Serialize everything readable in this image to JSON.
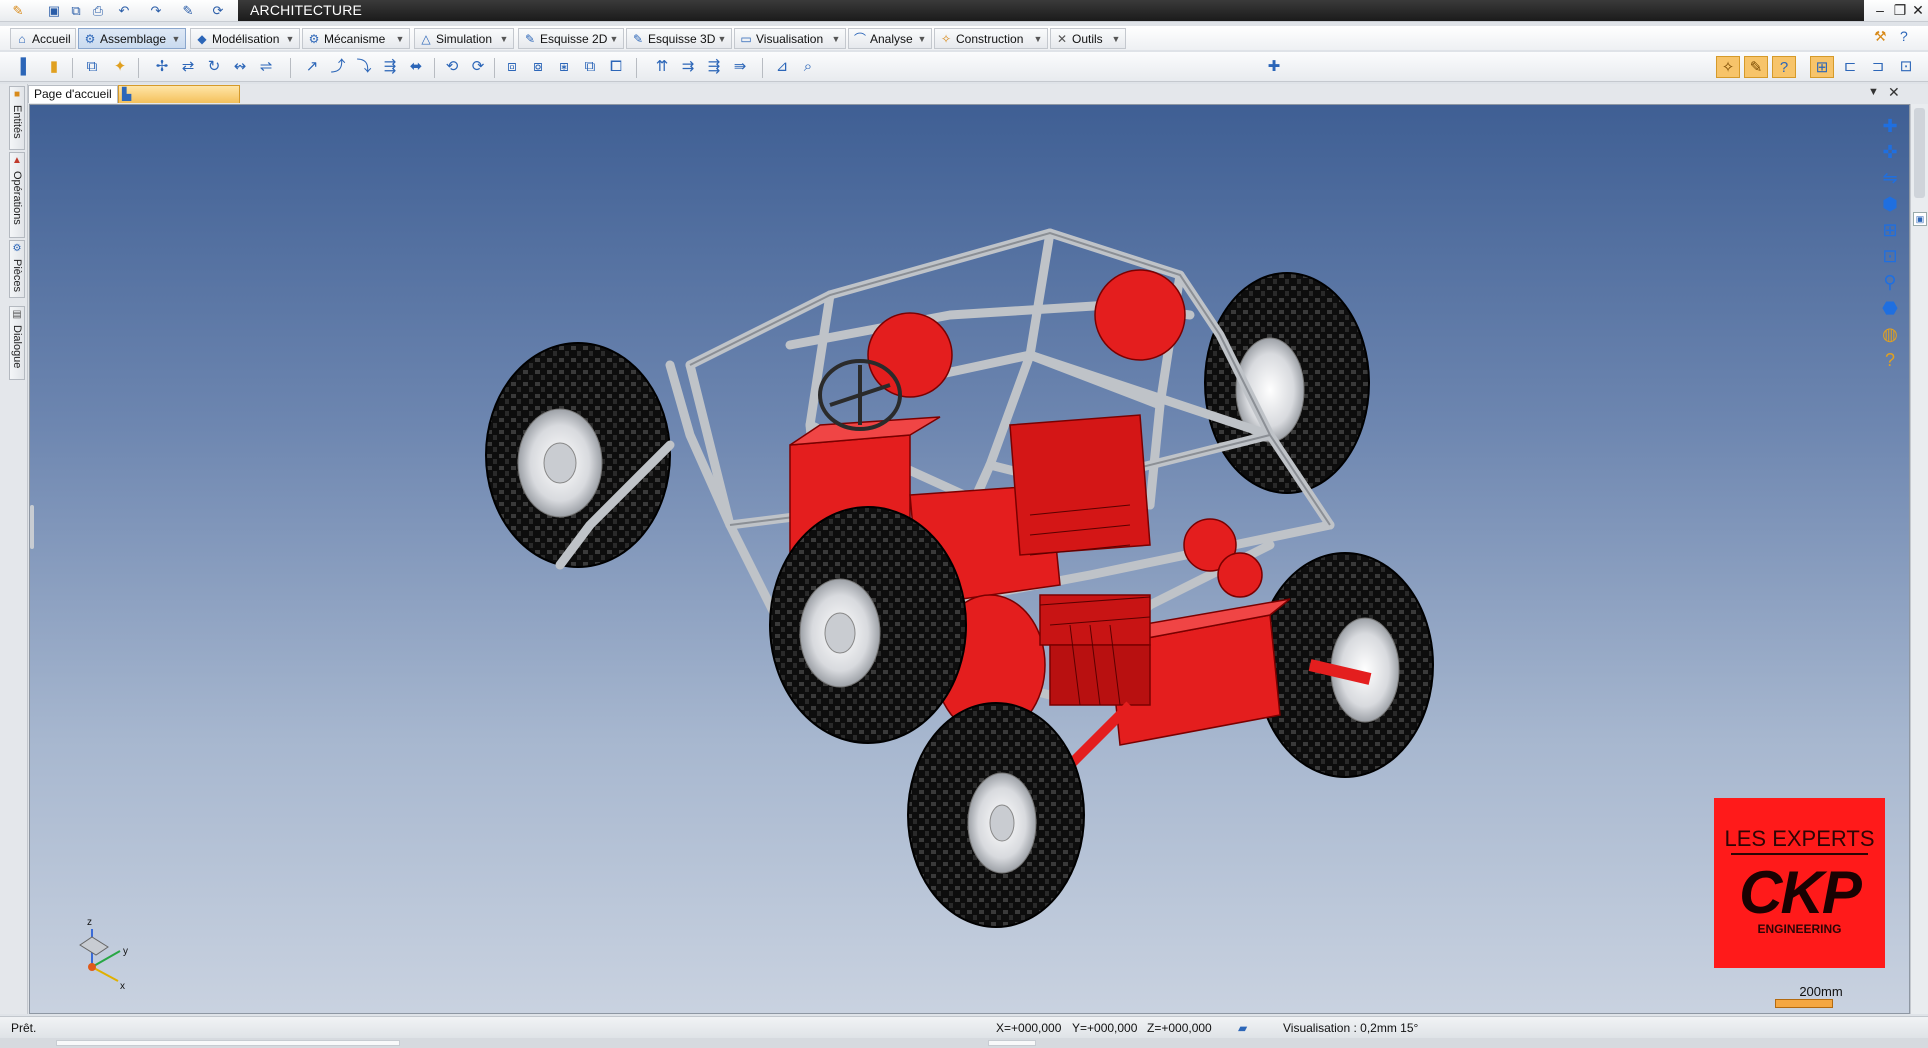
{
  "window": {
    "title": "ARCHITECTURE"
  },
  "tabs": [
    {
      "label": "Accueil",
      "icon": "home-icon"
    },
    {
      "label": "Assemblage",
      "icon": "assembly-icon"
    },
    {
      "label": "Modélisation",
      "icon": "modeling-icon"
    },
    {
      "label": "Mécanisme",
      "icon": "mechanism-icon"
    },
    {
      "label": "Simulation",
      "icon": "simulation-icon"
    },
    {
      "label": "Esquisse 2D",
      "icon": "sketch-2d-icon"
    },
    {
      "label": "Esquisse 3D",
      "icon": "sketch-3d-icon"
    },
    {
      "label": "Visualisation",
      "icon": "visualisation-icon"
    },
    {
      "label": "Analyse",
      "icon": "analysis-icon"
    },
    {
      "label": "Construction",
      "icon": "construction-icon"
    },
    {
      "label": "Outils",
      "icon": "tools-icon"
    }
  ],
  "documents": {
    "home_tab": "Page d'accueil"
  },
  "side_panel": {
    "tabs": [
      {
        "label": "Entités",
        "icon": "entities-icon"
      },
      {
        "label": "Opérations",
        "icon": "operations-icon"
      },
      {
        "label": "Pièces",
        "icon": "parts-icon"
      },
      {
        "label": "Dialogue",
        "icon": "dialog-icon"
      }
    ]
  },
  "viewport": {
    "model": "buggy-assembly",
    "triad": {
      "x": "x",
      "y": "y",
      "z": "z"
    },
    "logo": {
      "line1": "LES EXPERTS",
      "line2": "CKP",
      "line3": "ENGINEERING"
    },
    "scale_label": "200mm"
  },
  "status": {
    "text": "Prêt.",
    "x": "X=+000,000",
    "y": "Y=+000,000",
    "z": "Z=+000,000",
    "visualisation": "Visualisation : 0,2mm 15°"
  },
  "colors": {
    "accent": "#2c66b8",
    "model_red": "#e41e1e",
    "frame_grey": "#b8bcc2",
    "viewport_top": "#3f5f94",
    "viewport_bottom": "#c9d2e0",
    "logo_red": "#ff1a1a"
  }
}
